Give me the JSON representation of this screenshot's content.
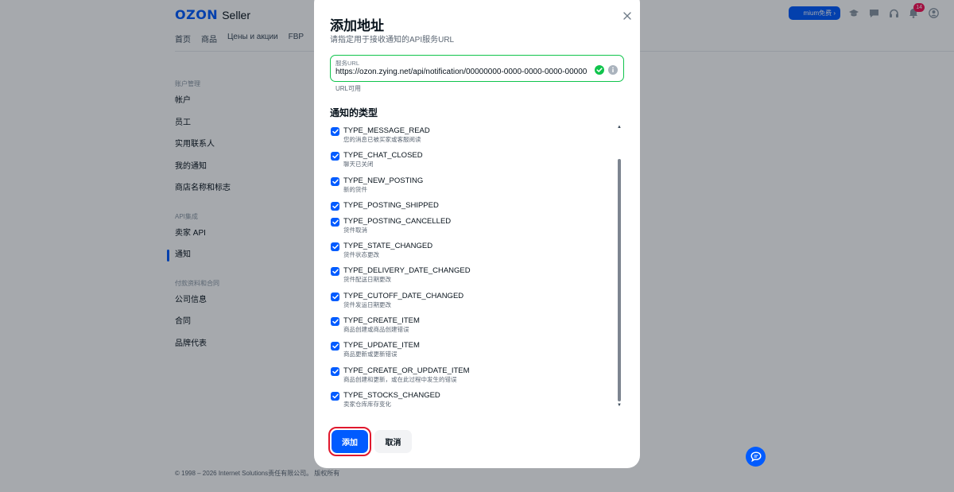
{
  "header": {
    "logo_brand": "OZON",
    "logo_product": "Seller",
    "nav": [
      "首页",
      "商品",
      "Цены и акции",
      "FBP"
    ],
    "premium_button": "mium免费 ›",
    "notifications_count": "14"
  },
  "sidebar": {
    "sections": [
      {
        "title": "账户管理",
        "items": [
          "帐户",
          "员工",
          "实用联系人",
          "我的通知",
          "商店名称和标志"
        ]
      },
      {
        "title": "API集成",
        "items": [
          "卖家 API",
          "通知"
        ]
      },
      {
        "title": "付款资料和合同",
        "items": [
          "公司信息",
          "合同",
          "品牌代表"
        ]
      }
    ],
    "active_item": "通知"
  },
  "footer": {
    "copyright": "© 1998 – 2026 Internet Solutions责任有限公司。 版权所有"
  },
  "modal": {
    "title": "添加地址",
    "subtitle": "请指定用于接收通知的API服务URL",
    "url_field": {
      "label": "服务URL",
      "value": "https://ozon.zying.net/api/notification/00000000-0000-0000-0000-000000000000",
      "hint": "URL可用",
      "status": "valid"
    },
    "section_title": "通知的类型",
    "notification_types": [
      {
        "name": "TYPE_MESSAGE_READ",
        "desc": "您的消息已被买家或客服阅读",
        "checked": true
      },
      {
        "name": "TYPE_CHAT_CLOSED",
        "desc": "聊天已关闭",
        "checked": true
      },
      {
        "name": "TYPE_NEW_POSTING",
        "desc": "新的货件",
        "checked": true
      },
      {
        "name": "TYPE_POSTING_SHIPPED",
        "desc": "",
        "checked": true
      },
      {
        "name": "TYPE_POSTING_CANCELLED",
        "desc": "货件取消",
        "checked": true
      },
      {
        "name": "TYPE_STATE_CHANGED",
        "desc": "货件状态更改",
        "checked": true
      },
      {
        "name": "TYPE_DELIVERY_DATE_CHANGED",
        "desc": "货件配送日期更改",
        "checked": true
      },
      {
        "name": "TYPE_CUTOFF_DATE_CHANGED",
        "desc": "货件发运日期更改",
        "checked": true
      },
      {
        "name": "TYPE_CREATE_ITEM",
        "desc": "商品创建或商品创建错误",
        "checked": true
      },
      {
        "name": "TYPE_UPDATE_ITEM",
        "desc": "商品更新或更新错误",
        "checked": true
      },
      {
        "name": "TYPE_CREATE_OR_UPDATE_ITEM",
        "desc": "商品创建和更新，或在此过程中发生的错误",
        "checked": true
      },
      {
        "name": "TYPE_STOCKS_CHANGED",
        "desc": "卖家仓库库存变化",
        "checked": true
      }
    ],
    "add_button": "添加",
    "cancel_button": "取消"
  },
  "colors": {
    "primary": "#005bff",
    "success": "#10c44c",
    "focus_ring": "#e0182d",
    "badge": "#f91155"
  }
}
